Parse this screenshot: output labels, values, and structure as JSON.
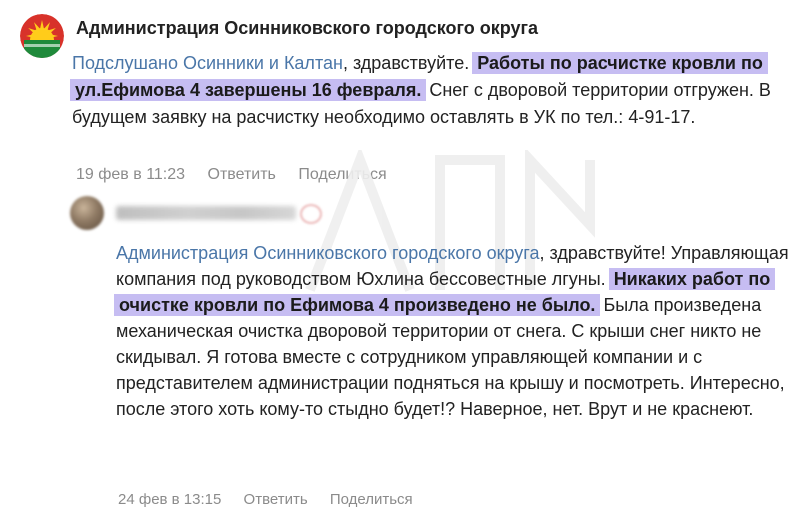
{
  "post": {
    "author": "Администрация Осинниковского городского округа",
    "mention": "Подслушано Осинники и Калтан",
    "text_after_mention": ", здравствуйте. ",
    "highlight": "Работы по расчистке кровли по ул.Ефимова 4 завершены 16 февраля.",
    "text_rest": " Снег с дворовой территории отгружен. В будущем заявку на расчистку необходимо оставлять в УК по тел.: 4-91-17.",
    "date": "19 фев в 11:23",
    "reply_label": "Ответить",
    "share_label": "Поделиться"
  },
  "reply": {
    "mention": "Администрация Осинниковского городского округа",
    "text_after_mention": ", здравствуйте! Управляющая компания под руководством Юхлина бессовестные лгуны. ",
    "highlight": "Никаких работ по очистке кровли по Ефимова 4 произведено не было.",
    "text_rest": " Была произведена механическая очистка дворовой территории от снега. С крыши снег никто не скидывал. Я готова вместе с сотрудником управляющей компании и с представителем администрации подняться на крышу и посмотреть. Интересно, после этого хоть кому-то стыдно будет!? Наверное, нет. Врут и не краснеют.",
    "date": "24 фев в 13:15",
    "reply_label": "Ответить",
    "share_label": "Поделиться"
  },
  "colors": {
    "link": "#4a76a8",
    "highlight": "#c6bdf2",
    "meta": "#8b8b8b"
  },
  "icons": {
    "main_avatar": "sun-emblem-logo",
    "reply_avatar": "blurred-user-photo"
  }
}
